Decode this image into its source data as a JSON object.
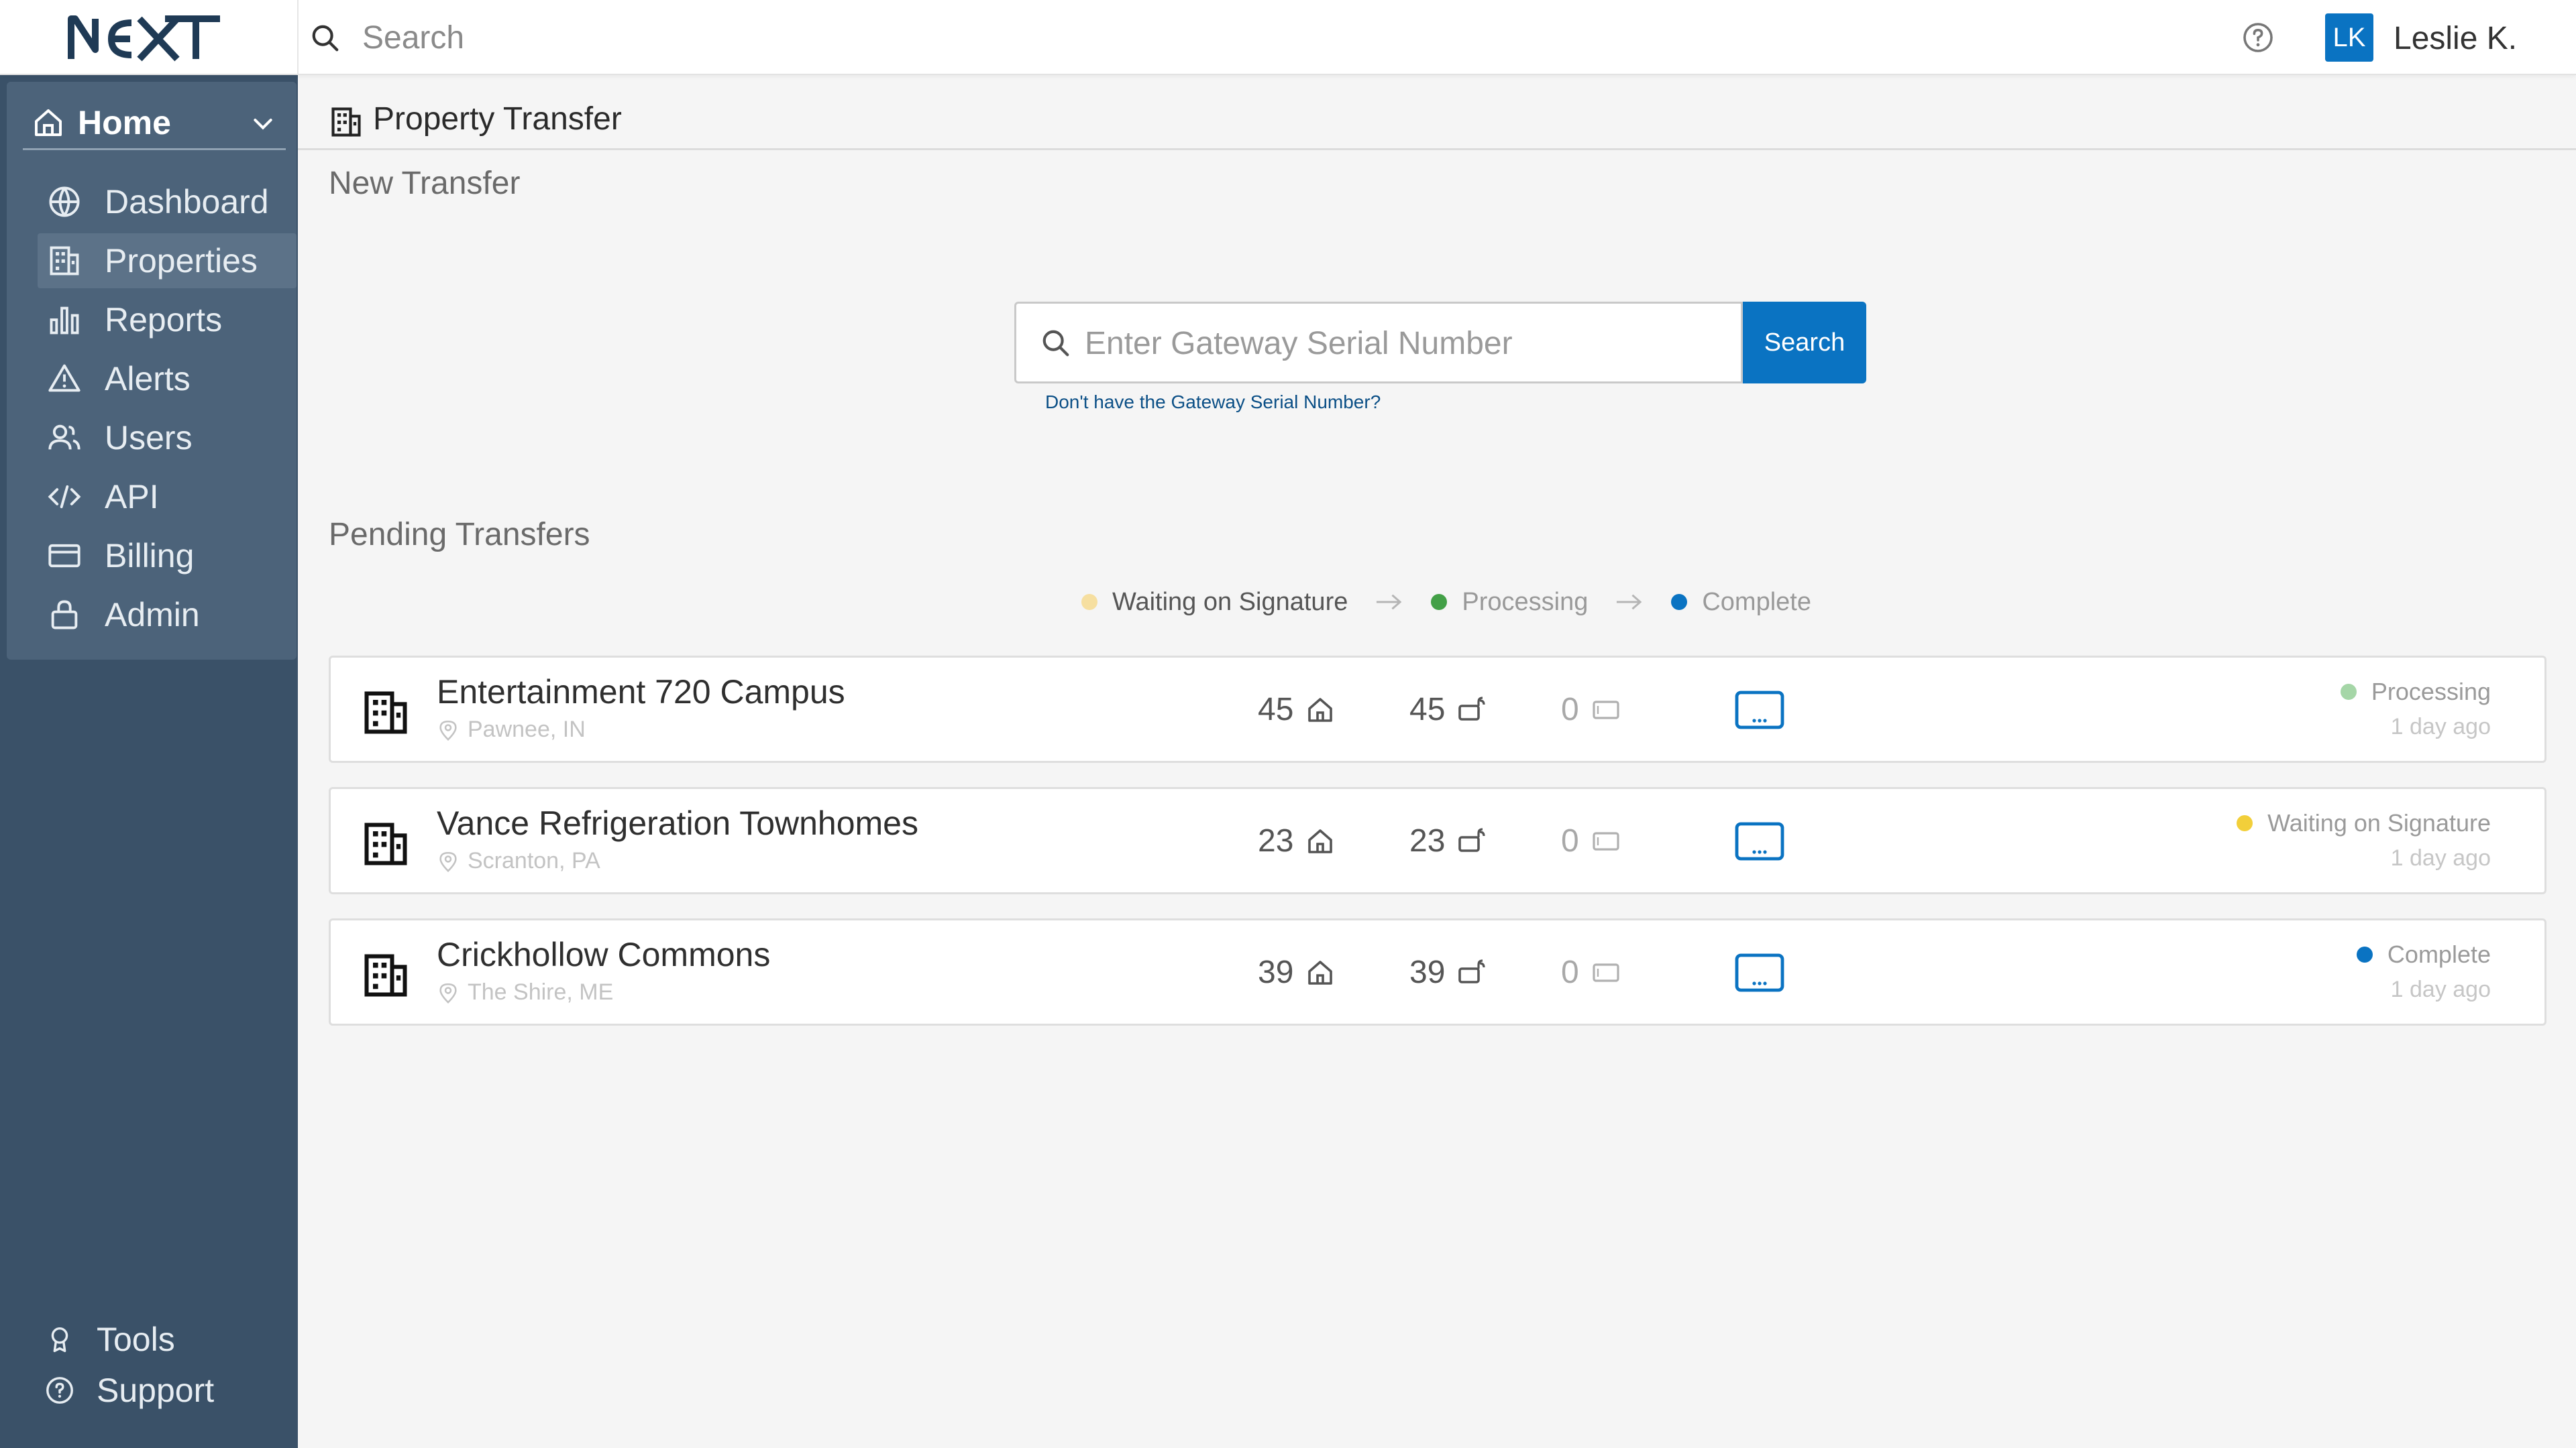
{
  "topbar": {
    "logo_text": "NEXT",
    "search_placeholder": "Search",
    "help_icon": "question-circle-icon",
    "user_initials": "LK",
    "user_name": "Leslie K."
  },
  "sidebar": {
    "home_label": "Home",
    "items": [
      {
        "label": "Dashboard",
        "icon": "globe-icon"
      },
      {
        "label": "Properties",
        "icon": "building-icon",
        "active": true
      },
      {
        "label": "Reports",
        "icon": "bar-chart-icon"
      },
      {
        "label": "Alerts",
        "icon": "warning-triangle-icon"
      },
      {
        "label": "Users",
        "icon": "users-icon"
      },
      {
        "label": "API",
        "icon": "code-icon"
      },
      {
        "label": "Billing",
        "icon": "credit-card-icon"
      },
      {
        "label": "Admin",
        "icon": "lock-icon"
      }
    ],
    "bottom": [
      {
        "label": "Tools",
        "icon": "badge-icon"
      },
      {
        "label": "Support",
        "icon": "help-icon"
      }
    ]
  },
  "page": {
    "title": "Property Transfer",
    "new_transfer_title": "New Transfer",
    "serial_placeholder": "Enter Gateway Serial Number",
    "search_button": "Search",
    "serial_help_link": "Don't have the Gateway Serial Number?",
    "pending_title": "Pending Transfers"
  },
  "legend": [
    {
      "label": "Waiting on Signature",
      "color": "#f6dfa0"
    },
    {
      "label": "Processing",
      "color": "#43a047"
    },
    {
      "label": "Complete",
      "color": "#0a73c2"
    }
  ],
  "transfers": [
    {
      "name": "Entertainment 720 Campus",
      "location": "Pawnee, IN",
      "units": "45",
      "devices": "45",
      "other": "0",
      "status": "Processing",
      "status_color": "#a5d6a7",
      "time": "1 day ago"
    },
    {
      "name": "Vance Refrigeration Townhomes",
      "location": "Scranton, PA",
      "units": "23",
      "devices": "23",
      "other": "0",
      "status": "Waiting on Signature",
      "status_color": "#f2cf3a",
      "time": "1 day ago"
    },
    {
      "name": "Crickhollow Commons",
      "location": "The Shire, ME",
      "units": "39",
      "devices": "39",
      "other": "0",
      "status": "Complete",
      "status_color": "#0a73c2",
      "time": "1 day ago"
    }
  ],
  "colors": {
    "accent": "#0a73c2",
    "sidebar_bg": "#3a5168",
    "sidebar_panel": "#4c637a"
  }
}
